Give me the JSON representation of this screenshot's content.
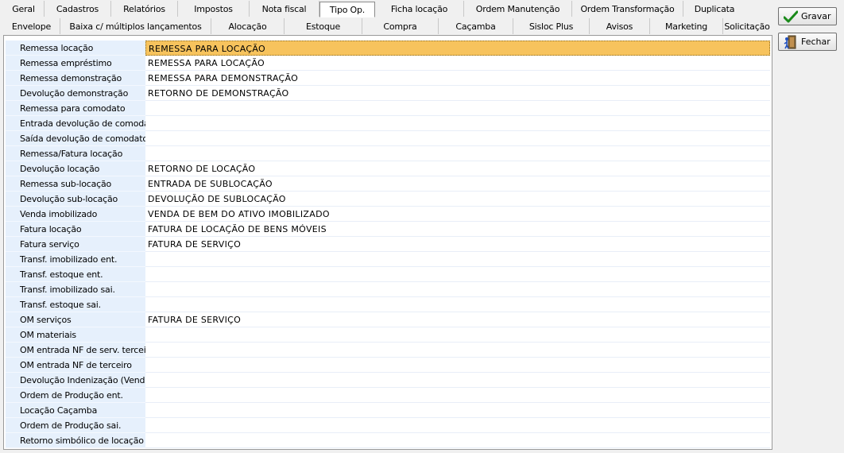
{
  "tabs": {
    "row1": [
      {
        "label": "Geral",
        "w": 52
      },
      {
        "label": "Cadastros",
        "w": 84
      },
      {
        "label": "Relatórios",
        "w": 84
      },
      {
        "label": "Impostos",
        "w": 90
      },
      {
        "label": "Nota fiscal",
        "w": 88
      },
      {
        "label": "Tipo Op.",
        "w": 70,
        "active": true
      },
      {
        "label": "Ficha locação",
        "w": 112
      },
      {
        "label": "Ordem Manutenção",
        "w": 136
      },
      {
        "label": "Ordem Transformação",
        "w": 140
      },
      {
        "label": "Duplicata",
        "w": 78
      }
    ],
    "row2": [
      {
        "label": "Envelope",
        "w": 72
      },
      {
        "label": "Baixa c/ múltiplos lançamentos",
        "w": 190
      },
      {
        "label": "Alocação",
        "w": 92
      },
      {
        "label": "Estoque",
        "w": 98
      },
      {
        "label": "Compra",
        "w": 96
      },
      {
        "label": "Caçamba",
        "w": 94
      },
      {
        "label": "Sisloc Plus",
        "w": 96
      },
      {
        "label": "Avisos",
        "w": 76
      },
      {
        "label": "Marketing",
        "w": 92
      },
      {
        "label": "Solicitação",
        "w": 60
      }
    ]
  },
  "buttons": {
    "gravar": "Gravar",
    "fechar": "Fechar"
  },
  "grid": [
    {
      "label": "Remessa locação",
      "value": "REMESSA PARA LOCAÇÃO",
      "selected": true
    },
    {
      "label": "Remessa empréstimo",
      "value": "REMESSA PARA LOCAÇÃO"
    },
    {
      "label": "Remessa demonstração",
      "value": "REMESSA PARA DEMONSTRAÇÃO"
    },
    {
      "label": "Devolução demonstração",
      "value": "RETORNO DE DEMONSTRAÇÃO"
    },
    {
      "label": "Remessa para comodato",
      "value": ""
    },
    {
      "label": "Entrada devolução de comodato",
      "value": ""
    },
    {
      "label": "Saída devolução de comodato",
      "value": ""
    },
    {
      "label": "Remessa/Fatura locação",
      "value": ""
    },
    {
      "label": "Devolução locação",
      "value": "RETORNO DE LOCAÇÃO"
    },
    {
      "label": "Remessa sub-locação",
      "value": "ENTRADA DE SUBLOCAÇÃO"
    },
    {
      "label": "Devolução sub-locação",
      "value": "DEVOLUÇÃO DE SUBLOCAÇÃO"
    },
    {
      "label": "Venda imobilizado",
      "value": "VENDA DE BEM DO ATIVO IMOBILIZADO"
    },
    {
      "label": "Fatura locação",
      "value": "FATURA DE LOCAÇÃO DE BENS MÓVEIS"
    },
    {
      "label": "Fatura serviço",
      "value": "FATURA DE SERVIÇO"
    },
    {
      "label": "Transf. imobilizado ent.",
      "value": ""
    },
    {
      "label": "Transf. estoque ent.",
      "value": ""
    },
    {
      "label": "Transf. imobilizado sai.",
      "value": ""
    },
    {
      "label": "Transf. estoque sai.",
      "value": ""
    },
    {
      "label": "OM serviços",
      "value": "FATURA DE SERVIÇO"
    },
    {
      "label": "OM materiais",
      "value": ""
    },
    {
      "label": "OM entrada NF de serv. terceiro",
      "value": ""
    },
    {
      "label": "OM entrada NF de terceiro",
      "value": ""
    },
    {
      "label": "Devolução Indenização (Venda L",
      "value": ""
    },
    {
      "label": "Ordem de Produção ent.",
      "value": ""
    },
    {
      "label": "Locação Caçamba",
      "value": ""
    },
    {
      "label": "Ordem de Produção sai.",
      "value": ""
    },
    {
      "label": "Retorno simbólico de locação",
      "value": ""
    }
  ]
}
